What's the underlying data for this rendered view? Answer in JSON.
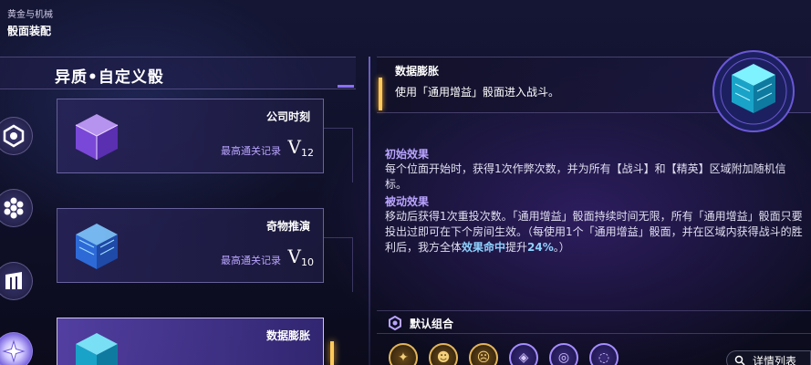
{
  "breadcrumb": {
    "parent": "黄金与机械",
    "title": "骰面装配"
  },
  "section": {
    "title": "异质•自定义骰"
  },
  "cards": [
    {
      "name": "公司时刻",
      "record_label": "最高通关记录",
      "record_letter": "V",
      "record_level": "12",
      "cube_color": "#a66bff"
    },
    {
      "name": "奇物推演",
      "record_label": "最高通关记录",
      "record_letter": "V",
      "record_level": "10",
      "cube_color": "#4aa8ff"
    },
    {
      "name": "数据膨胀",
      "cube_color": "#2fd6ff"
    }
  ],
  "detail": {
    "name": "数据膨胀",
    "description": "使用「通用增益」骰面进入战斗。",
    "effects": [
      {
        "title": "初始效果",
        "text": "每个位面开始时，获得1次作弊次数，并为所有【战斗】和【精英】区域附加随机信标。"
      },
      {
        "title": "被动效果",
        "text_before": "移动后获得1次重投次数。「通用增益」骰面持续时间无限，所有「通用增益」骰面只要投出过即可在下个房间生效。（每使用1个「通用增益」骰面，并在区域内获得战斗的胜利后，我方全体",
        "highlight_1": "效果命中",
        "text_middle": "提升",
        "highlight_2": "24%",
        "text_after": "。）"
      }
    ]
  },
  "combo": {
    "label": "默认组合"
  },
  "detail_list_button": {
    "label": "详情列表"
  },
  "tokens": [
    {
      "icon": "gold-mask-icon",
      "glyph": "✦",
      "style": "gold"
    },
    {
      "icon": "gold-mask-icon",
      "glyph": "☻",
      "style": "gold"
    },
    {
      "icon": "gold-mask-icon",
      "glyph": "☹",
      "style": "gold"
    },
    {
      "icon": "purple-mask-icon",
      "glyph": "◈",
      "style": "purple"
    },
    {
      "icon": "purple-swirl-icon",
      "glyph": "◎",
      "style": "purple"
    },
    {
      "icon": "purple-swirl-icon",
      "glyph": "◌",
      "style": "purple"
    }
  ],
  "colors": {
    "accent_gold": "#ffcb5a",
    "accent_purple": "#8a70ff",
    "highlight_blue": "#8fd2ff"
  }
}
